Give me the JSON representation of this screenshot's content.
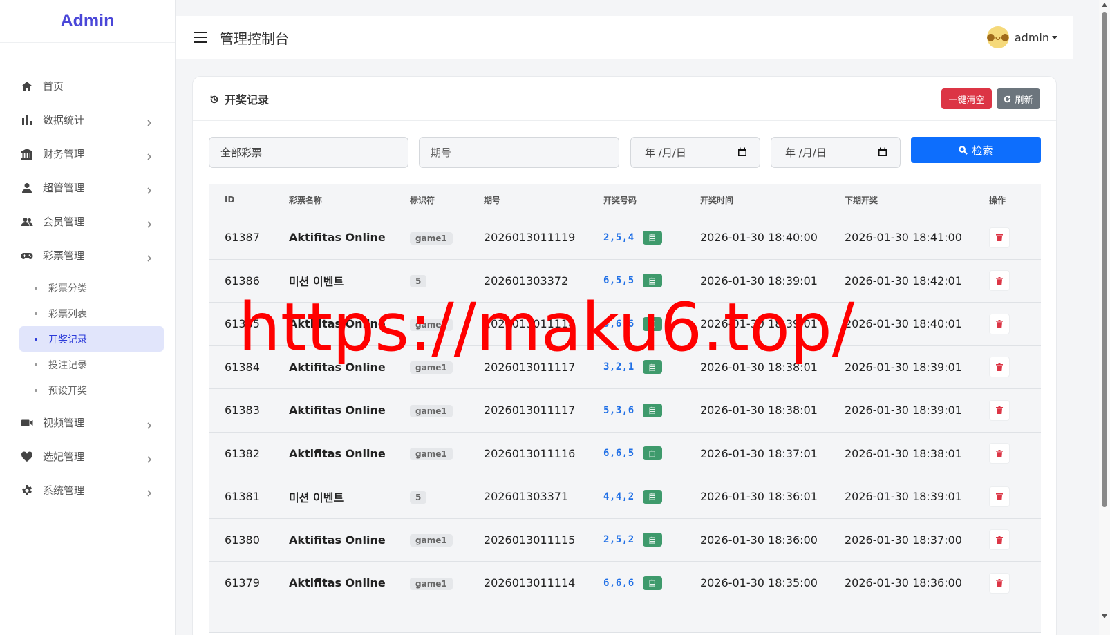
{
  "brand": "Admin",
  "header": {
    "title": "管理控制台",
    "user": "admin"
  },
  "sidebar": {
    "items": [
      {
        "label": "首页",
        "icon": "home-icon",
        "has_children": false
      },
      {
        "label": "数据统计",
        "icon": "bar-chart-icon",
        "has_children": true
      },
      {
        "label": "财务管理",
        "icon": "bank-icon",
        "has_children": true
      },
      {
        "label": "超管管理",
        "icon": "user-icon",
        "has_children": true
      },
      {
        "label": "会员管理",
        "icon": "users-icon",
        "has_children": true
      },
      {
        "label": "彩票管理",
        "icon": "gamepad-icon",
        "has_children": true
      }
    ],
    "sub_items": [
      {
        "label": "彩票分类",
        "active": false
      },
      {
        "label": "彩票列表",
        "active": false
      },
      {
        "label": "开奖记录",
        "active": true
      },
      {
        "label": "投注记录",
        "active": false
      },
      {
        "label": "预设开奖",
        "active": false
      }
    ],
    "items_after": [
      {
        "label": "视频管理",
        "icon": "video-icon",
        "has_children": true
      },
      {
        "label": "选妃管理",
        "icon": "heart-icon",
        "has_children": true
      },
      {
        "label": "系统管理",
        "icon": "gear-icon",
        "has_children": true
      }
    ]
  },
  "card": {
    "title": "开奖记录",
    "clear_label": "一键清空",
    "refresh_label": "刷新"
  },
  "filters": {
    "lottery_select": "全部彩票",
    "issue_placeholder": "期号",
    "date_start": "年 /月/日",
    "date_end": "年 /月/日",
    "search_label": "检索"
  },
  "table": {
    "headers": [
      "ID",
      "彩票名称",
      "标识符",
      "期号",
      "开奖号码",
      "开奖时间",
      "下期开奖",
      "操作"
    ],
    "auto_label": "自",
    "rows": [
      {
        "id": "61387",
        "name": "Aktifitas Online",
        "symbol": "game1",
        "issue": "2026013011119",
        "numbers": "2,5,4",
        "time": "2026-01-30 18:40:00",
        "next": "2026-01-30 18:41:00"
      },
      {
        "id": "61386",
        "name": "미션 이벤트",
        "symbol": "5",
        "issue": "202601303372",
        "numbers": "6,5,5",
        "time": "2026-01-30 18:39:01",
        "next": "2026-01-30 18:42:01"
      },
      {
        "id": "61385",
        "name": "Aktifitas Online",
        "symbol": "game1",
        "issue": "2026013011118",
        "numbers": "5,6,6",
        "time": "2026-01-30 18:39:01",
        "next": "2026-01-30 18:40:01"
      },
      {
        "id": "61384",
        "name": "Aktifitas Online",
        "symbol": "game1",
        "issue": "2026013011117",
        "numbers": "3,2,1",
        "time": "2026-01-30 18:38:01",
        "next": "2026-01-30 18:39:01"
      },
      {
        "id": "61383",
        "name": "Aktifitas Online",
        "symbol": "game1",
        "issue": "2026013011117",
        "numbers": "5,3,6",
        "time": "2026-01-30 18:38:01",
        "next": "2026-01-30 18:39:01"
      },
      {
        "id": "61382",
        "name": "Aktifitas Online",
        "symbol": "game1",
        "issue": "2026013011116",
        "numbers": "6,6,5",
        "time": "2026-01-30 18:37:01",
        "next": "2026-01-30 18:38:01"
      },
      {
        "id": "61381",
        "name": "미션 이벤트",
        "symbol": "5",
        "issue": "202601303371",
        "numbers": "4,4,2",
        "time": "2026-01-30 18:36:01",
        "next": "2026-01-30 18:39:01"
      },
      {
        "id": "61380",
        "name": "Aktifitas Online",
        "symbol": "game1",
        "issue": "2026013011115",
        "numbers": "2,5,2",
        "time": "2026-01-30 18:36:00",
        "next": "2026-01-30 18:37:00"
      },
      {
        "id": "61379",
        "name": "Aktifitas Online",
        "symbol": "game1",
        "issue": "2026013011114",
        "numbers": "6,6,6",
        "time": "2026-01-30 18:35:00",
        "next": "2026-01-30 18:36:00"
      }
    ]
  },
  "watermark": "https://maku6.top/",
  "colors": {
    "brand": "#4a47d8",
    "primary": "#0d6efd",
    "danger": "#dc3545",
    "secondary": "#6c757d",
    "success": "#3e9a6c",
    "number": "#1f6fe6",
    "watermark": "#ff0000"
  }
}
